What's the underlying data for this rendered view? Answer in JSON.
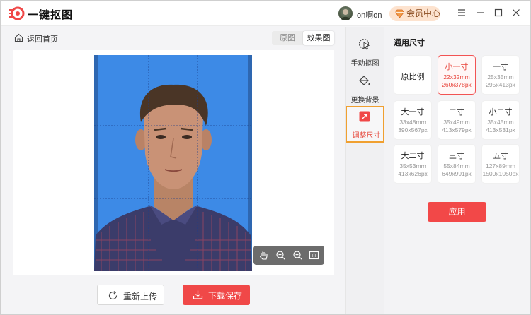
{
  "app": {
    "title": "一键抠图",
    "username": "on啊on",
    "vip_label": "会员中心"
  },
  "colors": {
    "accent": "#f04848",
    "photo_background": "#3d8ae6",
    "active_outline": "#f0a030"
  },
  "nav": {
    "back_label": "返回首页"
  },
  "view_toggle": {
    "options": [
      "原图",
      "效果图"
    ],
    "selected": "效果图"
  },
  "zoom_toolbar": {
    "icons": [
      "hand-icon",
      "zoom-out-icon",
      "zoom-in-icon",
      "compare-icon"
    ]
  },
  "actions": {
    "reupload_label": "重新上传",
    "download_label": "下载保存"
  },
  "tools": [
    {
      "label": "手动抠图",
      "icon": "cursor-icon"
    },
    {
      "label": "更换背景",
      "icon": "paint-bucket-icon"
    },
    {
      "label": "调整尺寸",
      "icon": "resize-icon"
    }
  ],
  "active_tool": "调整尺寸",
  "size_panel": {
    "title": "通用尺寸",
    "sizes": [
      {
        "name": "原比例",
        "mm": "",
        "px": ""
      },
      {
        "name": "小一寸",
        "mm": "22x32mm",
        "px": "260x378px"
      },
      {
        "name": "一寸",
        "mm": "25x35mm",
        "px": "295x413px"
      },
      {
        "name": "大一寸",
        "mm": "33x48mm",
        "px": "390x567px"
      },
      {
        "name": "二寸",
        "mm": "35x49mm",
        "px": "413x579px"
      },
      {
        "name": "小二寸",
        "mm": "35x45mm",
        "px": "413x531px"
      },
      {
        "name": "大二寸",
        "mm": "35x53mm",
        "px": "413x626px"
      },
      {
        "name": "三寸",
        "mm": "55x84mm",
        "px": "649x991px"
      },
      {
        "name": "五寸",
        "mm": "127x89mm",
        "px": "1500x1050px"
      }
    ],
    "selected": "小一寸",
    "apply_label": "应用"
  }
}
